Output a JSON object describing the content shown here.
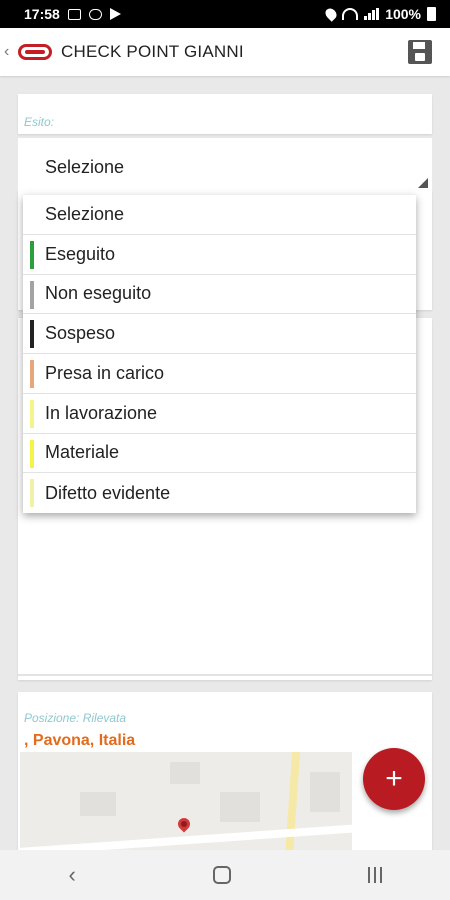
{
  "status_bar": {
    "time": "17:58",
    "battery": "100%"
  },
  "app_bar": {
    "title": "CHECK POINT GIANNI",
    "logo_color": "#c41e24"
  },
  "esito": {
    "label": "Esito:",
    "selected_value": "Selezione"
  },
  "dropdown": {
    "options": [
      {
        "label": "Selezione",
        "color": ""
      },
      {
        "label": "Eseguito",
        "color": "#2e9e3a"
      },
      {
        "label": "Non eseguito",
        "color": "#a3a3a3"
      },
      {
        "label": "Sospeso",
        "color": "#222222"
      },
      {
        "label": "Presa in carico",
        "color": "#e8a77a"
      },
      {
        "label": "In lavorazione",
        "color": "#f3f48a"
      },
      {
        "label": "Materiale",
        "color": "#f7f24a"
      },
      {
        "label": "Difetto evidente",
        "color": "#f3f1a8"
      }
    ]
  },
  "position": {
    "label": "Posizione: Rilevata",
    "value": ", Pavona, Italia",
    "value_color": "#e26b1e"
  },
  "fab": {
    "symbol": "+",
    "color": "#b81c22"
  },
  "icons": {
    "back": "back-icon",
    "save": "save-icon",
    "map_pin": "map-pin-icon"
  }
}
